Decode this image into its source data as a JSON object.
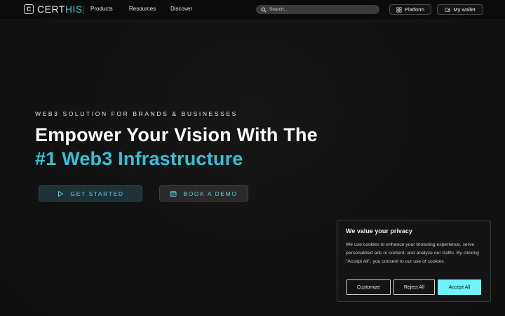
{
  "brand": {
    "logo_letter": "C",
    "name_prefix": "CERT",
    "name_highlight": "HIS",
    "accent_color": "#33c3d8"
  },
  "nav": {
    "items": [
      {
        "label": "Products"
      },
      {
        "label": "Resources"
      },
      {
        "label": "Discover"
      }
    ]
  },
  "search": {
    "placeholder": "Search..."
  },
  "header_buttons": {
    "platform_label": "Platform",
    "wallet_label": "My wallet"
  },
  "hero": {
    "eyebrow": "WEB3 SOLUTION FOR BRANDS & BUSINESSES",
    "headline_line1": "Empower Your Vision With The",
    "headline_line2": "#1 Web3 Infrastructure",
    "cta_primary": "GET STARTED",
    "cta_secondary": "BOOK A DEMO"
  },
  "cookie_banner": {
    "title": "We value your privacy",
    "text": "We use cookies to enhance your browsing experience, serve personalized ads or content, and analyze our traffic. By clicking \"Accept All\", you consent to our use of cookies.",
    "customize_label": "Customize",
    "reject_label": "Reject All",
    "accept_label": "Accept All",
    "accept_color": "#6ff3fb"
  },
  "icons": {
    "search": "search-icon",
    "platform": "grid-icon",
    "wallet": "wallet-icon",
    "play": "play-icon",
    "calendar": "calendar-icon"
  }
}
